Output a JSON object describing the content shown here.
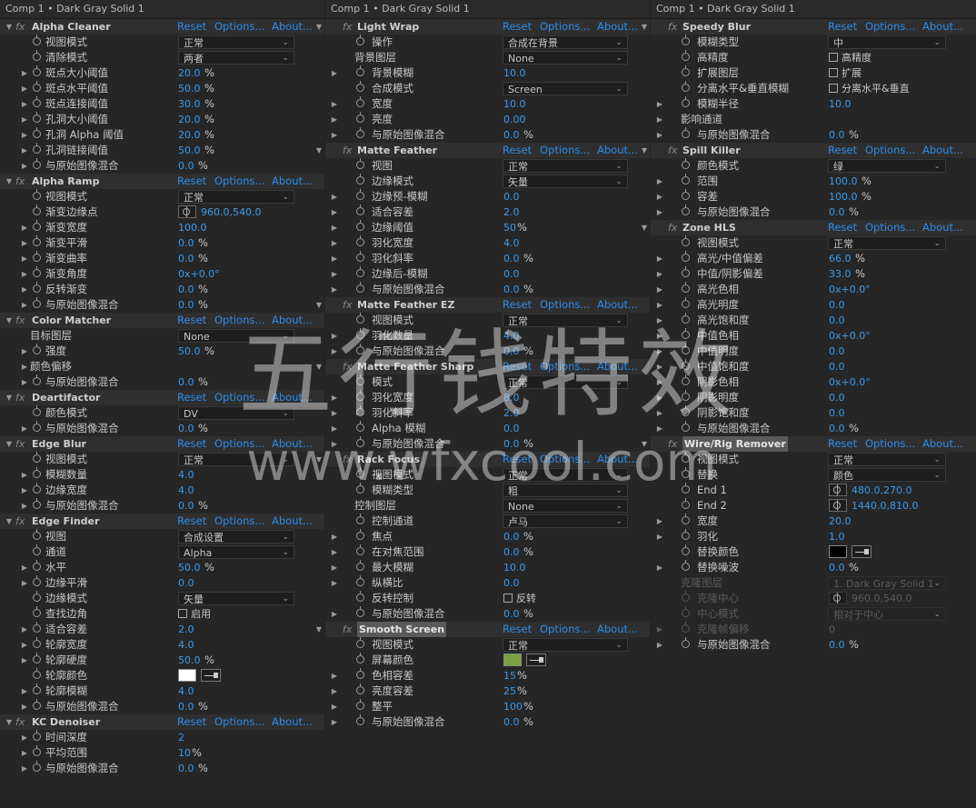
{
  "panels": [
    {
      "title": "Comp 1 • Dark Gray Solid 1",
      "rows": [
        {
          "t": "fx",
          "n": "Alpha Cleaner"
        },
        {
          "t": "p",
          "n": "视图模式",
          "k": "dd",
          "v": "正常"
        },
        {
          "t": "p",
          "n": "清除模式",
          "k": "dd",
          "v": "两者"
        },
        {
          "t": "p",
          "n": "斑点大小阈值",
          "k": "num",
          "v": "20.0",
          "u": "%",
          "tw": 1
        },
        {
          "t": "p",
          "n": "斑点水平阈值",
          "k": "num",
          "v": "50.0",
          "u": "%",
          "tw": 1
        },
        {
          "t": "p",
          "n": "斑点连接阈值",
          "k": "num",
          "v": "30.0",
          "u": "%",
          "tw": 1
        },
        {
          "t": "p",
          "n": "孔洞大小阈值",
          "k": "num",
          "v": "20.0",
          "u": "%",
          "tw": 1
        },
        {
          "t": "p",
          "n": "孔洞 Alpha 阈值",
          "k": "num",
          "v": "20.0",
          "u": "%",
          "tw": 1
        },
        {
          "t": "p",
          "n": "孔洞链接阈值",
          "k": "num",
          "v": "50.0",
          "u": "%",
          "tw": 1
        },
        {
          "t": "p",
          "n": "与原始图像混合",
          "k": "num",
          "v": "0.0",
          "u": "%",
          "tw": 1
        },
        {
          "t": "fx",
          "n": "Alpha Ramp"
        },
        {
          "t": "p",
          "n": "视图模式",
          "k": "dd",
          "v": "正常"
        },
        {
          "t": "p",
          "n": "渐变边缘点",
          "k": "pt",
          "v": "960.0,540.0"
        },
        {
          "t": "p",
          "n": "渐变宽度",
          "k": "num",
          "v": "100.0",
          "tw": 1
        },
        {
          "t": "p",
          "n": "渐变平滑",
          "k": "num",
          "v": "0.0",
          "u": "%",
          "tw": 1
        },
        {
          "t": "p",
          "n": "渐变曲率",
          "k": "num",
          "v": "0.0",
          "u": "%",
          "tw": 1
        },
        {
          "t": "p",
          "n": "渐变角度",
          "k": "num",
          "v": "0x+0.0°",
          "tw": 1
        },
        {
          "t": "p",
          "n": "反转渐变",
          "k": "num",
          "v": "0.0",
          "u": "%",
          "tw": 1
        },
        {
          "t": "p",
          "n": "与原始图像混合",
          "k": "num",
          "v": "0.0",
          "u": "%",
          "tw": 1
        },
        {
          "t": "fx",
          "n": "Color Matcher"
        },
        {
          "t": "p",
          "n": "目标图层",
          "k": "dd",
          "v": "None",
          "ns": 1
        },
        {
          "t": "p",
          "n": "强度",
          "k": "num",
          "v": "50.0",
          "u": "%",
          "tw": 1
        },
        {
          "t": "p",
          "n": "颜色偏移",
          "k": "none",
          "tw": 1,
          "ns": 1
        },
        {
          "t": "p",
          "n": "与原始图像混合",
          "k": "num",
          "v": "0.0",
          "u": "%",
          "tw": 1
        },
        {
          "t": "fx",
          "n": "Deartifactor"
        },
        {
          "t": "p",
          "n": "颜色模式",
          "k": "dd",
          "v": "DV"
        },
        {
          "t": "p",
          "n": "与原始图像混合",
          "k": "num",
          "v": "0.0",
          "u": "%",
          "tw": 1
        },
        {
          "t": "fx",
          "n": "Edge Blur"
        },
        {
          "t": "p",
          "n": "视图模式",
          "k": "dd",
          "v": "正常"
        },
        {
          "t": "p",
          "n": "模糊数量",
          "k": "num",
          "v": "4.0",
          "tw": 1
        },
        {
          "t": "p",
          "n": "边缘宽度",
          "k": "num",
          "v": "4.0",
          "tw": 1
        },
        {
          "t": "p",
          "n": "与原始图像混合",
          "k": "num",
          "v": "0.0",
          "u": "%",
          "tw": 1
        },
        {
          "t": "fx",
          "n": "Edge Finder"
        },
        {
          "t": "p",
          "n": "视图",
          "k": "dd",
          "v": "合成设置"
        },
        {
          "t": "p",
          "n": "通道",
          "k": "dd",
          "v": "Alpha"
        },
        {
          "t": "p",
          "n": "水平",
          "k": "num",
          "v": "50.0",
          "u": "%",
          "tw": 1
        },
        {
          "t": "p",
          "n": "边缘平滑",
          "k": "num",
          "v": "0.0",
          "tw": 1
        },
        {
          "t": "p",
          "n": "边缘模式",
          "k": "dd",
          "v": "矢量"
        },
        {
          "t": "p",
          "n": "查找边角",
          "k": "cb",
          "v": "启用"
        },
        {
          "t": "p",
          "n": "适合容差",
          "k": "num",
          "v": "2.0",
          "tw": 1
        },
        {
          "t": "p",
          "n": "轮廓宽度",
          "k": "num",
          "v": "4.0",
          "tw": 1
        },
        {
          "t": "p",
          "n": "轮廓硬度",
          "k": "num",
          "v": "50.0",
          "u": "%",
          "tw": 1
        },
        {
          "t": "p",
          "n": "轮廓颜色",
          "k": "color",
          "c": "#ffffff"
        },
        {
          "t": "p",
          "n": "轮廓模糊",
          "k": "num",
          "v": "4.0",
          "tw": 1
        },
        {
          "t": "p",
          "n": "与原始图像混合",
          "k": "num",
          "v": "0.0",
          "u": "%",
          "tw": 1
        },
        {
          "t": "fx",
          "n": "KC Denoiser"
        },
        {
          "t": "p",
          "n": "时间深度",
          "k": "num",
          "v": "2",
          "tw": 1
        },
        {
          "t": "p",
          "n": "平均范围",
          "k": "num",
          "v": "10",
          "u": "%",
          "tw": 1
        },
        {
          "t": "p",
          "n": "与原始图像混合",
          "k": "num",
          "v": "0.0",
          "u": "%",
          "tw": 1
        }
      ]
    },
    {
      "title": "Comp 1 • Dark Gray Solid 1",
      "rows": [
        {
          "t": "fx",
          "n": "Light Wrap"
        },
        {
          "t": "p",
          "n": "操作",
          "k": "dd",
          "v": "合成在背景"
        },
        {
          "t": "p",
          "n": "背景图层",
          "k": "dd",
          "v": "None",
          "ns": 1
        },
        {
          "t": "p",
          "n": "背景模糊",
          "k": "num",
          "v": "10.0",
          "tw": 1
        },
        {
          "t": "p",
          "n": "合成模式",
          "k": "dd",
          "v": "Screen"
        },
        {
          "t": "p",
          "n": "宽度",
          "k": "num",
          "v": "10.0",
          "tw": 1
        },
        {
          "t": "p",
          "n": "亮度",
          "k": "num",
          "v": "0.00",
          "tw": 1
        },
        {
          "t": "p",
          "n": "与原始图像混合",
          "k": "num",
          "v": "0.0",
          "u": "%",
          "tw": 1
        },
        {
          "t": "fx",
          "n": "Matte Feather"
        },
        {
          "t": "p",
          "n": "视图",
          "k": "dd",
          "v": "正常"
        },
        {
          "t": "p",
          "n": "边缘模式",
          "k": "dd",
          "v": "矢量"
        },
        {
          "t": "p",
          "n": "边缘预-模糊",
          "k": "num",
          "v": "0.0",
          "tw": 1
        },
        {
          "t": "p",
          "n": "适合容差",
          "k": "num",
          "v": "2.0",
          "tw": 1
        },
        {
          "t": "p",
          "n": "边缘阈值",
          "k": "num",
          "v": "50",
          "u": "%",
          "tw": 1
        },
        {
          "t": "p",
          "n": "羽化宽度",
          "k": "num",
          "v": "4.0",
          "tw": 1
        },
        {
          "t": "p",
          "n": "羽化斜率",
          "k": "num",
          "v": "0.0",
          "u": "%",
          "tw": 1
        },
        {
          "t": "p",
          "n": "边缘后-模糊",
          "k": "num",
          "v": "0.0",
          "tw": 1
        },
        {
          "t": "p",
          "n": "与原始图像混合",
          "k": "num",
          "v": "0.0",
          "u": "%",
          "tw": 1
        },
        {
          "t": "fx",
          "n": "Matte Feather EZ"
        },
        {
          "t": "p",
          "n": "视图模式",
          "k": "dd",
          "v": "正常"
        },
        {
          "t": "p",
          "n": "羽化数量",
          "k": "num",
          "v": "4.0",
          "tw": 1
        },
        {
          "t": "p",
          "n": "与原始图像混合",
          "k": "num",
          "v": "0.0",
          "u": "%",
          "tw": 1
        },
        {
          "t": "fx",
          "n": "Matte Feather Sharp"
        },
        {
          "t": "p",
          "n": "模式",
          "k": "dd",
          "v": "正常"
        },
        {
          "t": "p",
          "n": "羽化宽度",
          "k": "num",
          "v": "8.0",
          "tw": 1
        },
        {
          "t": "p",
          "n": "羽化斜率",
          "k": "num",
          "v": "2.0",
          "tw": 1
        },
        {
          "t": "p",
          "n": "Alpha 模糊",
          "k": "num",
          "v": "0.0",
          "tw": 1
        },
        {
          "t": "p",
          "n": "与原始图像混合",
          "k": "num",
          "v": "0.0",
          "u": "%",
          "tw": 1
        },
        {
          "t": "fx",
          "n": "Rack Focus"
        },
        {
          "t": "p",
          "n": "视图模式",
          "k": "dd",
          "v": "正常"
        },
        {
          "t": "p",
          "n": "模糊类型",
          "k": "dd",
          "v": "粗"
        },
        {
          "t": "p",
          "n": "控制图层",
          "k": "dd",
          "v": "None",
          "ns": 1
        },
        {
          "t": "p",
          "n": "控制通道",
          "k": "dd",
          "v": "卢马"
        },
        {
          "t": "p",
          "n": "焦点",
          "k": "num",
          "v": "0.0",
          "u": "%",
          "tw": 1
        },
        {
          "t": "p",
          "n": "在对焦范围",
          "k": "num",
          "v": "0.0",
          "u": "%",
          "tw": 1
        },
        {
          "t": "p",
          "n": "最大模糊",
          "k": "num",
          "v": "10.0",
          "tw": 1
        },
        {
          "t": "p",
          "n": "纵横比",
          "k": "num",
          "v": "0.0",
          "tw": 1
        },
        {
          "t": "p",
          "n": "反转控制",
          "k": "cb",
          "v": "反转"
        },
        {
          "t": "p",
          "n": "与原始图像混合",
          "k": "num",
          "v": "0.0",
          "u": "%",
          "tw": 1
        },
        {
          "t": "fx",
          "n": "Smooth Screen",
          "hl": 1
        },
        {
          "t": "p",
          "n": "视图模式",
          "k": "dd",
          "v": "正常"
        },
        {
          "t": "p",
          "n": "屏幕颜色",
          "k": "color",
          "c": "#7aa040"
        },
        {
          "t": "p",
          "n": "色相容差",
          "k": "num",
          "v": "15",
          "u": "%",
          "tw": 1
        },
        {
          "t": "p",
          "n": "亮度容差",
          "k": "num",
          "v": "25",
          "u": "%",
          "tw": 1
        },
        {
          "t": "p",
          "n": "整平",
          "k": "num",
          "v": "100",
          "u": "%",
          "tw": 1
        },
        {
          "t": "p",
          "n": "与原始图像混合",
          "k": "num",
          "v": "0.0",
          "u": "%",
          "tw": 1
        }
      ]
    },
    {
      "title": "Comp 1 • Dark Gray Solid 1",
      "rows": [
        {
          "t": "fx",
          "n": "Speedy Blur"
        },
        {
          "t": "p",
          "n": "模糊类型",
          "k": "dd",
          "v": "中"
        },
        {
          "t": "p",
          "n": "高精度",
          "k": "cb",
          "v": "高精度"
        },
        {
          "t": "p",
          "n": "扩展图层",
          "k": "cb",
          "v": "扩展"
        },
        {
          "t": "p",
          "n": "分离水平&垂直模糊",
          "k": "cb",
          "v": "分离水平&垂直"
        },
        {
          "t": "p",
          "n": "模糊半径",
          "k": "num",
          "v": "10.0",
          "tw": 1
        },
        {
          "t": "p",
          "n": "影响通道",
          "k": "none",
          "tw": 1,
          "ns": 1
        },
        {
          "t": "p",
          "n": "与原始图像混合",
          "k": "num",
          "v": "0.0",
          "u": "%",
          "tw": 1
        },
        {
          "t": "fx",
          "n": "Spill Killer"
        },
        {
          "t": "p",
          "n": "颜色模式",
          "k": "dd",
          "v": "绿"
        },
        {
          "t": "p",
          "n": "范围",
          "k": "num",
          "v": "100.0",
          "u": "%",
          "tw": 1
        },
        {
          "t": "p",
          "n": "容差",
          "k": "num",
          "v": "100.0",
          "u": "%",
          "tw": 1
        },
        {
          "t": "p",
          "n": "与原始图像混合",
          "k": "num",
          "v": "0.0",
          "u": "%",
          "tw": 1
        },
        {
          "t": "fx",
          "n": "Zone HLS"
        },
        {
          "t": "p",
          "n": "视图模式",
          "k": "dd",
          "v": "正常"
        },
        {
          "t": "p",
          "n": "高光/中值偏差",
          "k": "num",
          "v": "66.0",
          "u": "%",
          "tw": 1
        },
        {
          "t": "p",
          "n": "中值/阴影偏差",
          "k": "num",
          "v": "33.0",
          "u": "%",
          "tw": 1
        },
        {
          "t": "p",
          "n": "高光色相",
          "k": "num",
          "v": "0x+0.0°",
          "tw": 1
        },
        {
          "t": "p",
          "n": "高光明度",
          "k": "num",
          "v": "0.0",
          "tw": 1
        },
        {
          "t": "p",
          "n": "高光饱和度",
          "k": "num",
          "v": "0.0",
          "tw": 1
        },
        {
          "t": "p",
          "n": "中值色相",
          "k": "num",
          "v": "0x+0.0°",
          "tw": 1
        },
        {
          "t": "p",
          "n": "中值明度",
          "k": "num",
          "v": "0.0",
          "tw": 1
        },
        {
          "t": "p",
          "n": "中值饱和度",
          "k": "num",
          "v": "0.0",
          "tw": 1
        },
        {
          "t": "p",
          "n": "阴影色相",
          "k": "num",
          "v": "0x+0.0°",
          "tw": 1
        },
        {
          "t": "p",
          "n": "阴影明度",
          "k": "num",
          "v": "0.0",
          "tw": 1
        },
        {
          "t": "p",
          "n": "阴影饱和度",
          "k": "num",
          "v": "0.0",
          "tw": 1
        },
        {
          "t": "p",
          "n": "与原始图像混合",
          "k": "num",
          "v": "0.0",
          "u": "%",
          "tw": 1
        },
        {
          "t": "fx",
          "n": "Wire/Rig Remover",
          "hl": 1
        },
        {
          "t": "p",
          "n": "视图模式",
          "k": "dd",
          "v": "正常"
        },
        {
          "t": "p",
          "n": "替换",
          "k": "dd",
          "v": "颜色"
        },
        {
          "t": "p",
          "n": "End 1",
          "k": "pt",
          "v": "480.0,270.0"
        },
        {
          "t": "p",
          "n": "End 2",
          "k": "pt",
          "v": "1440.0,810.0"
        },
        {
          "t": "p",
          "n": "宽度",
          "k": "num",
          "v": "20.0",
          "tw": 1
        },
        {
          "t": "p",
          "n": "羽化",
          "k": "num",
          "v": "1.0",
          "tw": 1
        },
        {
          "t": "p",
          "n": "替换颜色",
          "k": "color",
          "c": "#000000"
        },
        {
          "t": "p",
          "n": "替换噪波",
          "k": "num",
          "v": "0.0",
          "u": "%",
          "tw": 1
        },
        {
          "t": "p",
          "n": "克隆图层",
          "k": "dd",
          "v": "1. Dark Gray Solid 1",
          "ns": 1,
          "dim": 1
        },
        {
          "t": "p",
          "n": "克隆中心",
          "k": "pt",
          "v": "960.0,540.0",
          "dim": 1
        },
        {
          "t": "p",
          "n": "中心模式",
          "k": "dd",
          "v": "相对于中心",
          "dim": 1
        },
        {
          "t": "p",
          "n": "克隆帧偏移",
          "k": "num",
          "v": "0",
          "tw": 1,
          "dim": 1
        },
        {
          "t": "p",
          "n": "与原始图像混合",
          "k": "num",
          "v": "0.0",
          "u": "%",
          "tw": 1
        }
      ]
    }
  ],
  "links": {
    "reset": "Reset",
    "options": "Options...",
    "about": "About..."
  },
  "watermark": {
    "cn": "五行钱特效",
    "url": "www.wfxcool.com"
  },
  "colors": {
    "link": "#2d8ceb",
    "value": "#3b9cf0"
  }
}
